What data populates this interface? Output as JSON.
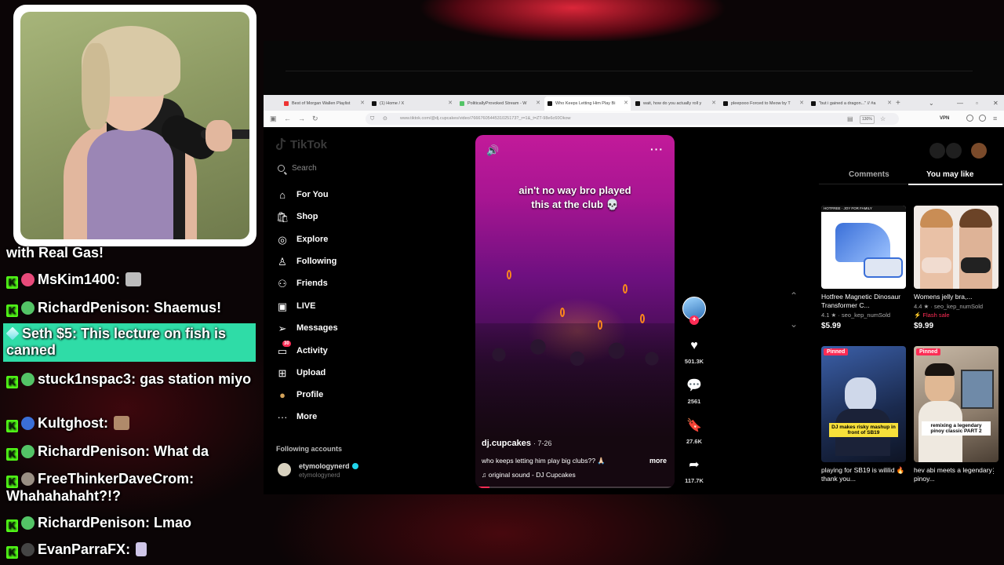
{
  "chat": [
    {
      "user": "",
      "text": "with Real Gas!",
      "type": "cut"
    },
    {
      "user": "MsKim1400",
      "text": "",
      "type": "emote",
      "avatar_color": "#e84a7a"
    },
    {
      "user": "RichardPenison",
      "text": "Shaemus!",
      "type": "normal",
      "avatar_color": "#53c466"
    },
    {
      "user": "Seth $5",
      "text": "This lecture on fish is canned",
      "type": "highlight"
    },
    {
      "user": "stuck1nspac3",
      "text": "gas station miyo",
      "type": "normal",
      "avatar_color": "#53c466"
    },
    {
      "user": "Kultghost",
      "text": "",
      "type": "emote",
      "avatar_color": "#3a6fd8"
    },
    {
      "user": "RichardPenison",
      "text": "What da",
      "type": "normal",
      "avatar_color": "#53c466"
    },
    {
      "user": "FreeThinkerDaveCrom",
      "text": "Whahahahaht?!?",
      "type": "normal",
      "avatar_color": "#9a8f84"
    },
    {
      "user": "RichardPenison",
      "text": "Lmao",
      "type": "normal",
      "avatar_color": "#53c466"
    },
    {
      "user": "EvanParraFX",
      "text": "",
      "type": "emote",
      "avatar_color": "#555"
    }
  ],
  "browser": {
    "tabs": [
      {
        "label": "Best of Morgan Wallen Playlist",
        "fav_color": "#e33"
      },
      {
        "label": "(1) Home / X",
        "fav_color": "#111"
      },
      {
        "label": "PoliticallyProvoked Stream - W",
        "fav_color": "#53c466"
      },
      {
        "label": "Who Keeps Letting Him Play Bi",
        "fav_color": "#111"
      },
      {
        "label": "wait, how do you actually roll y",
        "fav_color": "#111"
      },
      {
        "label": "pleepooo Forced to Meow by T",
        "fav_color": "#111"
      },
      {
        "label": "\"but i gained a dragon...\" // #a",
        "fav_color": "#111"
      }
    ],
    "url": "www.tiktok.com/@dj.cupcakes/video/7666760544531025173?_r=1&_t=ZT-98e6c60Okow",
    "zoom": "130%",
    "vpn": "VPN"
  },
  "tiktok": {
    "logo": "TikTok",
    "search_placeholder": "Search",
    "nav": [
      {
        "icon": "home-icon",
        "glyph": "⌂",
        "label": "For You"
      },
      {
        "icon": "shop-icon",
        "glyph": "🛍",
        "label": "Shop"
      },
      {
        "icon": "compass-icon",
        "glyph": "◎",
        "label": "Explore"
      },
      {
        "icon": "following-icon",
        "glyph": "♙",
        "label": "Following"
      },
      {
        "icon": "friends-icon",
        "glyph": "⚇",
        "label": "Friends"
      },
      {
        "icon": "live-icon",
        "glyph": "▣",
        "label": "LIVE"
      },
      {
        "icon": "messages-icon",
        "glyph": "➢",
        "label": "Messages"
      },
      {
        "icon": "activity-icon",
        "glyph": "▭",
        "label": "Activity",
        "badge": "30"
      },
      {
        "icon": "upload-icon",
        "glyph": "⊞",
        "label": "Upload"
      },
      {
        "icon": "profile-icon",
        "glyph": "●",
        "label": "Profile"
      },
      {
        "icon": "more-icon",
        "glyph": "···",
        "label": "More"
      }
    ],
    "following_title": "Following accounts",
    "following": {
      "name": "etymologynerd",
      "handle": "etymologynerd"
    },
    "video": {
      "caption_line1": "ain't no way bro played",
      "caption_line2": "this at the club 💀",
      "author": "dj.cupcakes",
      "date": "· 7-26",
      "description": "who keeps letting him play big clubs?? 🙏🏻",
      "more": "more",
      "sound": "♫  original sound - DJ Cupcakes",
      "progress": 0.07
    },
    "actions": {
      "likes": "501.3K",
      "comments": "2561",
      "saves": "27.6K",
      "shares": "117.7K"
    },
    "right_tabs": {
      "comments": "Comments",
      "you_may_like": "You may like"
    },
    "cards": [
      {
        "title": "Hotfree Magnetic Dinosaur Transformer C...",
        "rating": "4.1 ★ · seo_kep_numSold",
        "price": "$5.99",
        "thumb_label": "HOTFREE · JOY FOR FAMILY"
      },
      {
        "title": "Womens jelly bra,...",
        "rating": "4.4 ★ · seo_kep_numSold",
        "flash": "⚡ Flash sale",
        "price": "$9.99"
      },
      {
        "title": "playing for SB19 is wililid 🔥 thank you...",
        "pinned": "Pinned",
        "overlay": "DJ makes risky mashup in front of SB19"
      },
      {
        "title": "hev abi meets a legendary pinoy...",
        "pinned": "Pinned",
        "overlay": "remixing a legendary pinoy classic PART 2"
      }
    ]
  }
}
